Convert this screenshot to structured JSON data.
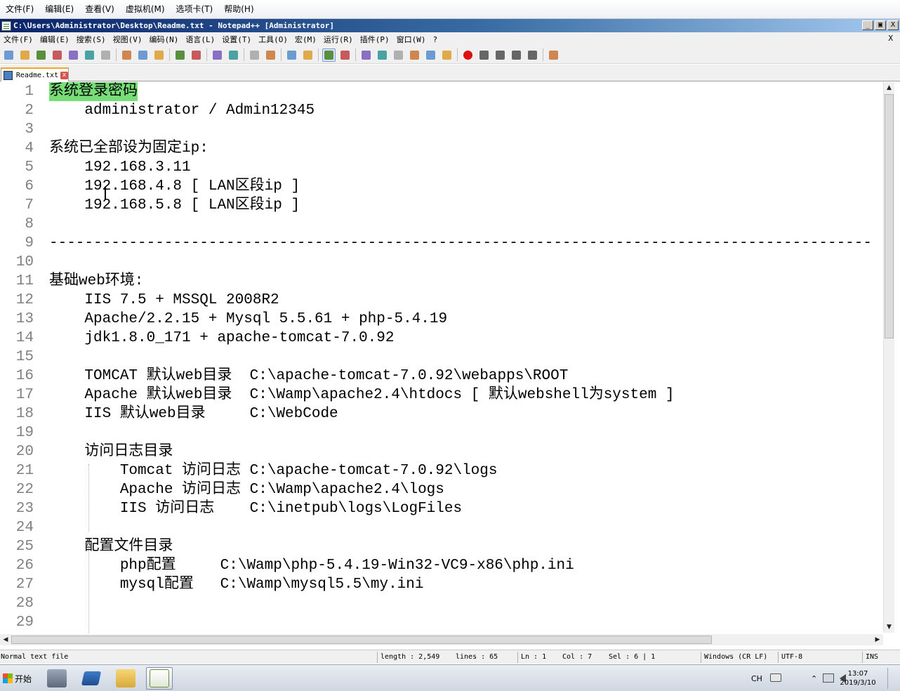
{
  "vm_menu": [
    "文件(F)",
    "编辑(E)",
    "查看(V)",
    "虚拟机(M)",
    "选项卡(T)",
    "帮助(H)"
  ],
  "window": {
    "title": "C:\\Users\\Administrator\\Desktop\\Readme.txt - Notepad++ [Administrator]",
    "buttons": [
      "_",
      "▣",
      "X"
    ]
  },
  "npp_menu": [
    "文件(F)",
    "编辑(E)",
    "搜索(S)",
    "视图(V)",
    "编码(N)",
    "语言(L)",
    "设置(T)",
    "工具(O)",
    "宏(M)",
    "运行(R)",
    "插件(P)",
    "窗口(W)",
    "?"
  ],
  "npp_close": "X",
  "toolbar_icons": [
    "new-file-icon",
    "open-file-icon",
    "save-icon",
    "save-all-icon",
    "close-icon",
    "close-all-icon",
    "print-icon",
    "sep",
    "cut-icon",
    "copy-icon",
    "paste-icon",
    "sep",
    "undo-icon",
    "redo-icon",
    "sep",
    "find-icon",
    "replace-icon",
    "sep",
    "zoom-in-icon",
    "zoom-out-icon",
    "sep",
    "sync-vertical-icon",
    "sync-horizontal-icon",
    "sep",
    "word-wrap-icon",
    "show-all-chars-icon",
    "sep",
    "indent-guide-icon",
    "udl-icon",
    "doc-map-icon",
    "function-list-icon",
    "folder-workspace-icon",
    "monitor-icon",
    "sep",
    "record-macro-icon",
    "stop-macro-icon",
    "play-macro-icon",
    "play-macro-multiple-icon",
    "save-macro-icon",
    "sep",
    "spellcheck-icon"
  ],
  "tab": {
    "label": "Readme.txt",
    "close": "x"
  },
  "editor": {
    "lines": [
      {
        "n": "1",
        "text": "系统登录密码",
        "highlight": true
      },
      {
        "n": "2",
        "text": "    administrator / Admin12345"
      },
      {
        "n": "3",
        "text": ""
      },
      {
        "n": "4",
        "text": "系统已全部设为固定ip:"
      },
      {
        "n": "5",
        "text": "    192.168.3.11"
      },
      {
        "n": "6",
        "text": "    192.168.4.8 [ LAN区段ip ]"
      },
      {
        "n": "7",
        "text": "    192.168.5.8 [ LAN区段ip ]"
      },
      {
        "n": "8",
        "text": ""
      },
      {
        "n": "9",
        "text": "---------------------------------------------------------------------------------------------"
      },
      {
        "n": "10",
        "text": ""
      },
      {
        "n": "11",
        "text": "基础web环境:"
      },
      {
        "n": "12",
        "text": "    IIS 7.5 + MSSQL 2008R2"
      },
      {
        "n": "13",
        "text": "    Apache/2.2.15 + Mysql 5.5.61 + php-5.4.19"
      },
      {
        "n": "14",
        "text": "    jdk1.8.0_171 + apache-tomcat-7.0.92"
      },
      {
        "n": "15",
        "text": ""
      },
      {
        "n": "16",
        "text": "    TOMCAT 默认web目录  C:\\apache-tomcat-7.0.92\\webapps\\ROOT"
      },
      {
        "n": "17",
        "text": "    Apache 默认web目录  C:\\Wamp\\apache2.4\\htdocs [ 默认webshell为system ]"
      },
      {
        "n": "18",
        "text": "    IIS 默认web目录     C:\\WebCode"
      },
      {
        "n": "19",
        "text": ""
      },
      {
        "n": "20",
        "text": "    访问日志目录"
      },
      {
        "n": "21",
        "text": "        Tomcat 访问日志 C:\\apache-tomcat-7.0.92\\logs"
      },
      {
        "n": "22",
        "text": "        Apache 访问日志 C:\\Wamp\\apache2.4\\logs"
      },
      {
        "n": "23",
        "text": "        IIS 访问日志    C:\\inetpub\\logs\\LogFiles"
      },
      {
        "n": "24",
        "text": ""
      },
      {
        "n": "25",
        "text": "    配置文件目录"
      },
      {
        "n": "26",
        "text": "        php配置     C:\\Wamp\\php-5.4.19-Win32-VC9-x86\\php.ini"
      },
      {
        "n": "27",
        "text": "        mysql配置   C:\\Wamp\\mysql5.5\\my.ini"
      },
      {
        "n": "28",
        "text": ""
      },
      {
        "n": "29",
        "text": ""
      }
    ]
  },
  "statusbar": {
    "filetype": "Normal text file",
    "length": "length : 2,549",
    "lines": "lines : 65",
    "ln": "Ln : 1",
    "col": "Col : 7",
    "sel": "Sel : 6 | 1",
    "eol": "Windows (CR LF)",
    "encoding": "UTF-8",
    "mode": "INS"
  },
  "taskbar": {
    "start_label": "开始",
    "lang": "CH",
    "time": "13:07",
    "date": "2019/3/10"
  },
  "colors": {
    "highlight": "#77dd77",
    "line_number": "#808080",
    "titlebar": "#0a246a"
  }
}
